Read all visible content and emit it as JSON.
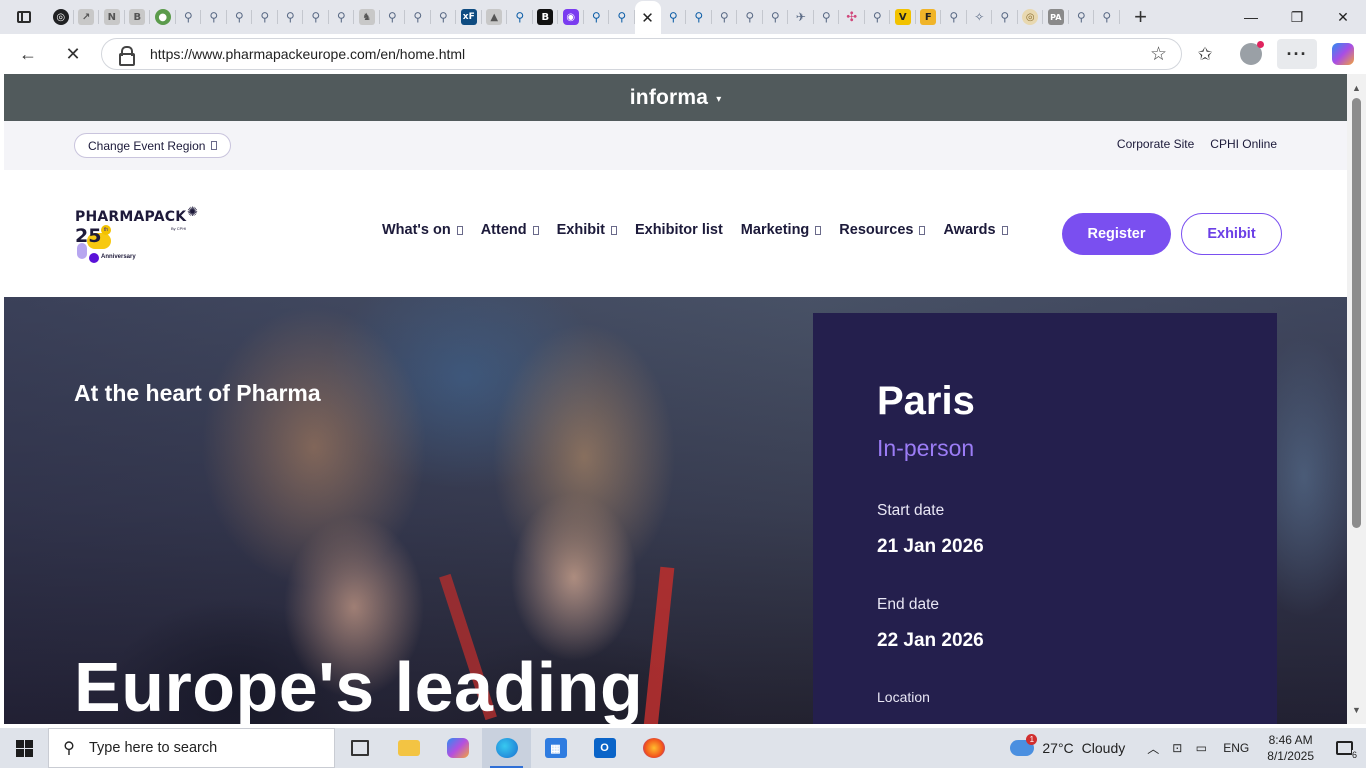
{
  "browser": {
    "tab_favicons": [
      "openai",
      "chart",
      "notion",
      "b-letter",
      "maps",
      "search",
      "search",
      "search",
      "search",
      "search",
      "search",
      "search",
      "chess",
      "search",
      "search",
      "search",
      "xf",
      "drive",
      "search-dark",
      "b-bold",
      "dots",
      "search-dark",
      "search-dark"
    ],
    "tab_favicons_after": [
      "search-dark",
      "search-dark",
      "search",
      "search",
      "search",
      "plane",
      "search",
      "pink",
      "search",
      "v",
      "flag",
      "search",
      "spark",
      "search",
      "beige",
      "pa",
      "search",
      "search"
    ],
    "active_tab_close": "✕",
    "new_tab": "+",
    "url": "https://www.pharmapackeurope.com/en/home.html"
  },
  "informa": {
    "brand": "informa",
    "caret": "▾"
  },
  "region_bar": {
    "change_region_label": "Change Event Region",
    "links": [
      "Corporate Site",
      "CPHI Online"
    ]
  },
  "logo": {
    "word": "PHARMAPACK",
    "sub": "By CPHI",
    "number": "25",
    "suffix": "th",
    "anniversary": "Anniversary"
  },
  "nav": {
    "items": [
      {
        "label": "What's on",
        "dropdown": true
      },
      {
        "label": "Attend",
        "dropdown": true
      },
      {
        "label": "Exhibit",
        "dropdown": true
      },
      {
        "label": "Exhibitor list",
        "dropdown": false
      },
      {
        "label": "Marketing",
        "dropdown": true
      },
      {
        "label": "Resources",
        "dropdown": true
      },
      {
        "label": "Awards",
        "dropdown": true
      }
    ],
    "register_label": "Register",
    "exhibit_label": "Exhibit"
  },
  "hero": {
    "tagline": "At the heart of Pharma",
    "headline": "Europe's leading"
  },
  "event_panel": {
    "city": "Paris",
    "mode": "In-person",
    "start_label": "Start date",
    "start_value": "21 Jan 2026",
    "end_label": "End date",
    "end_value": "22 Jan 2026",
    "location_label": "Location"
  },
  "taskbar": {
    "search_placeholder": "Type here to search",
    "weather_temp": "27°C",
    "weather_desc": "Cloudy",
    "weather_badge": "1",
    "language": "ENG",
    "time": "8:46 AM",
    "date": "8/1/2025",
    "notification_count": "6"
  },
  "colors": {
    "informa_bar": "#515a5c",
    "accent_purple": "#7a4ff0",
    "panel_navy": "#241f4d",
    "mode_lavender": "#9b7cf5"
  }
}
